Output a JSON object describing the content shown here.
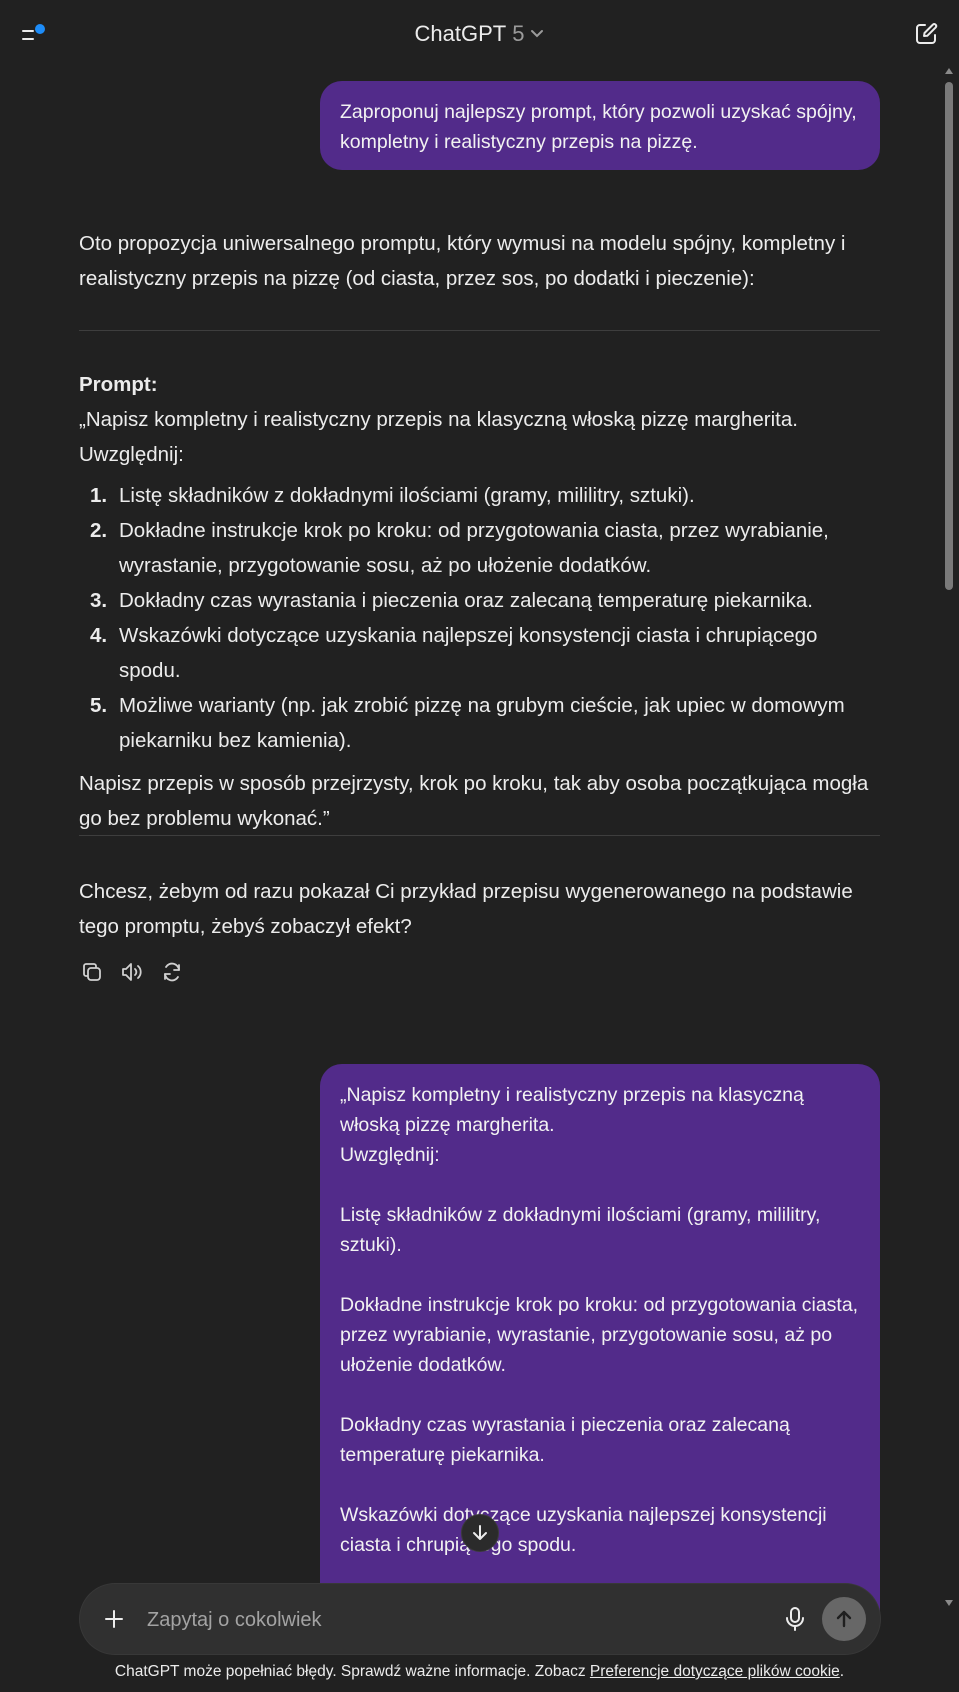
{
  "header": {
    "model_name": "ChatGPT",
    "model_version": "5"
  },
  "messages": {
    "user1": "Zaproponuj najlepszy prompt, który pozwoli uzyskać spójny, kompletny i realistyczny przepis na pizzę.",
    "assistant": {
      "intro": "Oto propozycja uniwersalnego promptu, który wymusi na modelu spójny, kompletny i realistyczny przepis na pizzę (od ciasta, przez sos, po dodatki i pieczenie):",
      "prompt_title": "Prompt:",
      "prompt_line1": "„Napisz kompletny i realistyczny przepis na klasyczną włoską pizzę margherita.",
      "prompt_line2": "Uwzględnij:",
      "steps": [
        {
          "num": "1.",
          "text": "Listę składników z dokładnymi ilościami (gramy, mililitry, sztuki)."
        },
        {
          "num": "2.",
          "text": "Dokładne instrukcje krok po kroku: od przygotowania ciasta, przez wyrabianie, wyrastanie, przygotowanie sosu, aż po ułożenie dodatków."
        },
        {
          "num": "3.",
          "text": "Dokładny czas wyrastania i pieczenia oraz zalecaną temperaturę piekarnika."
        },
        {
          "num": "4.",
          "text": "Wskazówki dotyczące uzyskania najlepszej konsystencji ciasta i chrupiącego spodu."
        },
        {
          "num": "5.",
          "text": "Możliwe warianty (np. jak zrobić pizzę na grubym cieście, jak upiec w domowym piekarniku bez kamienia)."
        }
      ],
      "closing": "Napisz przepis w sposób przejrzysty, krok po kroku, tak aby osoba początkująca mogła go bez problemu wykonać.”",
      "question": "Chcesz, żebym od razu pokazał Ci przykład przepisu wygenerowanego na podstawie tego promptu, żebyś zobaczył efekt?"
    },
    "user2": [
      "„Napisz kompletny i realistyczny przepis na klasyczną włoską pizzę margherita.\nUwzględnij:",
      "Listę składników z dokładnymi ilościami (gramy, mililitry, sztuki).",
      "Dokładne instrukcje krok po kroku: od przygotowania ciasta, przez wyrabianie, wyrastanie, przygotowanie sosu, aż po ułożenie dodatków.",
      "Dokładny czas wyrastania i pieczenia oraz zalecaną temperaturę piekarnika.",
      "Wskazówki dotyczące uzyskania najlepszej konsystencji ciasta i chrupiącego spodu."
    ]
  },
  "icons": {
    "menu": "sidebar-menu-icon",
    "new_chat": "edit-icon",
    "copy": "copy-icon",
    "read_aloud": "speaker-icon",
    "regenerate": "refresh-icon",
    "scroll_down": "arrow-down-icon",
    "plus": "plus-icon",
    "mic": "microphone-icon",
    "send": "arrow-up-icon"
  },
  "composer": {
    "placeholder": "Zapytaj o cokolwiek"
  },
  "footer": {
    "text": "ChatGPT może popełniać błędy. Sprawdź ważne informacje. Zobacz ",
    "link": "Preferencje dotyczące plików cookie",
    "end": "."
  },
  "colors": {
    "background": "#212121",
    "user_bubble": "#522b8a",
    "notification_dot": "#1d8cf8",
    "composer": "#303030"
  }
}
